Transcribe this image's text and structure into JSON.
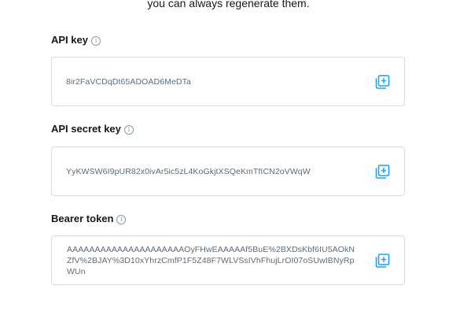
{
  "intro_text": "you can always regenerate them.",
  "fields": [
    {
      "label": "API key",
      "value": "8ir2FaVCDqDt65ADOAD6MeDTa"
    },
    {
      "label": "API secret key",
      "value": "YyKWSW6I9pUR82x0ivAr5ic5zL4KoGkjtXSQeKmTfICN2oVWqW"
    },
    {
      "label": "Bearer token",
      "value": "AAAAAAAAAAAAAAAAAAAAAOyFHwEAAAAAf5BuE%2BXDsKbf6IU5AOkNZfV%2BJAY%3D10xYhrzCmfP1F5Z48F7WLVSsIVhFhujLrOI07oSUwIBNyRpWUn"
    }
  ],
  "icons": {
    "info": "info-circle-icon",
    "copy": "copy-icon"
  },
  "colors": {
    "accent": "#1da1f2",
    "border": "#d5dbe0",
    "value_text": "#5b6b78"
  }
}
